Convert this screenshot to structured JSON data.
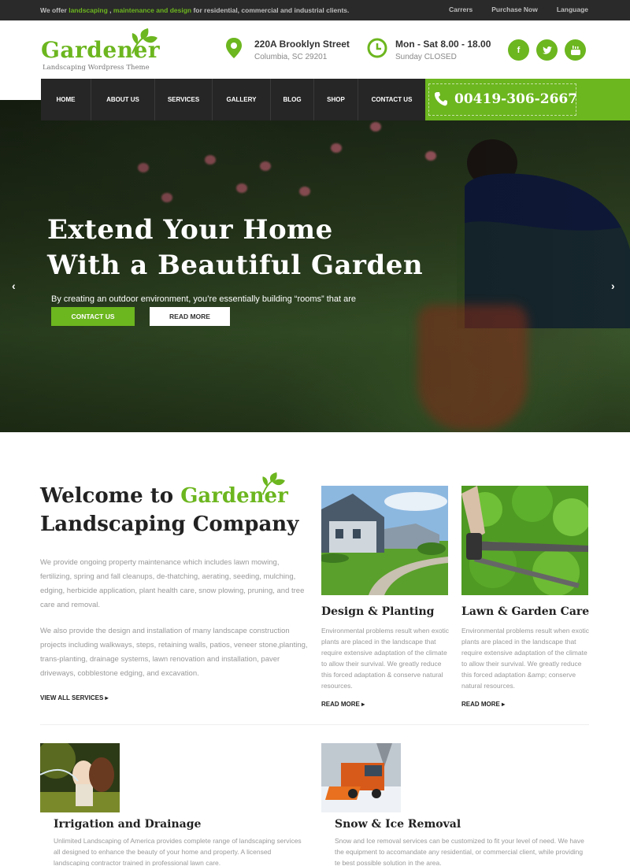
{
  "topbar": {
    "msg_pre": "We offer ",
    "msg_hl1": "landscaping",
    "msg_mid": " , ",
    "msg_hl2": "maintenance and design",
    "msg_post": " for residential, commercial and industrial clients.",
    "links": [
      "Carrers",
      "Purchase Now",
      "Language"
    ]
  },
  "logo": {
    "name": "Gardener",
    "tagline": "Landscaping Wordpress Theme"
  },
  "address": {
    "line1": "220A Brooklyn Street",
    "line2": "Columbia, SC 29201"
  },
  "hours": {
    "line1": "Mon - Sat 8.00 - 18.00",
    "line2": "Sunday CLOSED"
  },
  "social": [
    "facebook-icon",
    "twitter-icon",
    "youtube-icon"
  ],
  "nav": {
    "items": [
      "HOME",
      "ABOUT US",
      "SERVICES",
      "GALLERY",
      "BLOG",
      "SHOP",
      "CONTACT US"
    ],
    "phone": "00419-306-2667"
  },
  "hero": {
    "title_line1": "Extend Your Home",
    "title_line2": "With a Beautiful Garden",
    "lead": "By creating an outdoor environment, you’re essentially building “rooms” that are",
    "btn_contact": "CONTACT US",
    "btn_readmore": "READ MORE"
  },
  "welcome": {
    "title_a": "Welcome to ",
    "title_green": "Gardener",
    "title_b": "Landscaping Company",
    "para1": "We provide ongoing property maintenance which includes lawn mowing, fertilizing, spring and fall cleanups, de-thatching, aerating, seeding, mulching, edging, herbicide application, plant health care, snow plowing, pruning, and tree care and removal.",
    "para2": "We also provide the design and installation of many landscape construction projects including walkways, steps, retaining walls, patios, veneer stone,planting, trans-planting, drainage systems, lawn renovation and installation, paver driveways, cobblestone edging, and excavation.",
    "view_all": "VIEW ALL SERVICES"
  },
  "cards": [
    {
      "title": "Design & Planting",
      "text": "Environmental problems result when exotic plants are placed in the landscape that require extensive adaptation of the climate to allow their survival. We greatly reduce this forced adaptation & conserve natural resources.",
      "read_more": "READ MORE"
    },
    {
      "title": "Lawn & Garden Care",
      "text": "Environmental problems result when exotic plants are placed in the landscape that require extensive adaptation of the climate to allow their survival. We greatly reduce this forced adaptation &amp; conserve natural resources.",
      "read_more": "READ MORE"
    }
  ],
  "bottom": [
    {
      "title": "Irrigation and Drainage",
      "text": "Unlimited Landscaping of America provides complete range of landscaping services all designed to enhance the beauty of your home and property. A licensed landscaping contractor trained in professional lawn care."
    },
    {
      "title": "Snow & Ice Removal",
      "text": "Snow and Ice removal services can be customized to fit your level of need. We have the equipment to accomandate any residential, or commercial client, while providing te best possible solution in the area."
    }
  ],
  "colors": {
    "accent": "#6cb61f",
    "dark": "#262626",
    "topbar": "#2a2a2a"
  }
}
